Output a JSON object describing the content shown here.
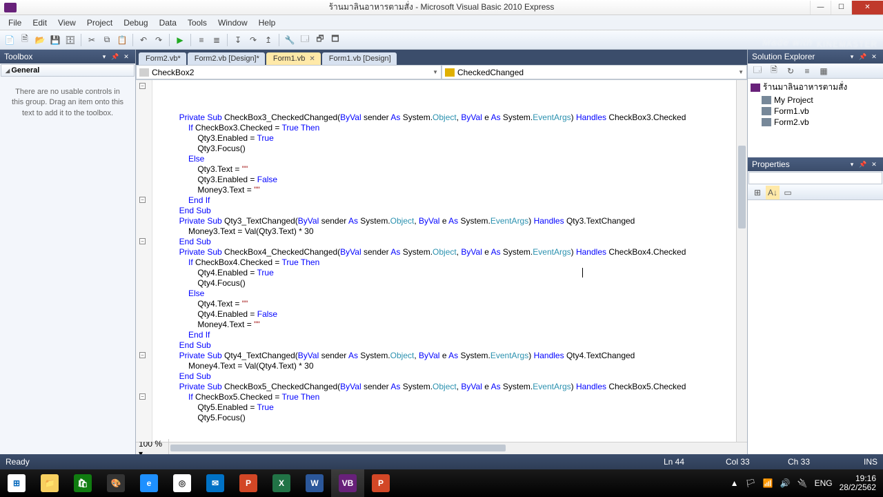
{
  "title": "ร้านมาลินอาหารตามสั่ง - Microsoft Visual Basic 2010 Express",
  "menu": [
    "File",
    "Edit",
    "View",
    "Project",
    "Debug",
    "Data",
    "Tools",
    "Window",
    "Help"
  ],
  "watermark_made": "Made with",
  "watermark": "KINEMASTER",
  "toolbox": {
    "title": "Toolbox",
    "category": "General",
    "message": "There are no usable controls in this group. Drag an item onto this text to add it to the toolbox."
  },
  "tabs": [
    {
      "label": "Form2.vb*",
      "active": false
    },
    {
      "label": "Form2.vb [Design]*",
      "active": false
    },
    {
      "label": "Form1.vb",
      "active": true,
      "close": true
    },
    {
      "label": "Form1.vb [Design]",
      "active": false
    }
  ],
  "dropdown_left": "CheckBox2",
  "dropdown_right": "CheckedChanged",
  "zoom": "100 %",
  "solution": {
    "title": "Solution Explorer",
    "project": "ร้านมาลินอาหารตามสั่ง",
    "items": [
      "My Project",
      "Form1.vb",
      "Form2.vb"
    ]
  },
  "properties": {
    "title": "Properties"
  },
  "status": {
    "ready": "Ready",
    "ln": "Ln 44",
    "col": "Col 33",
    "ch": "Ch 33",
    "ins": "INS"
  },
  "tray": {
    "lang": "ENG",
    "time": "19:16",
    "date": "28/2/2562"
  },
  "code_lines": [
    {
      "indent": 2,
      "tokens": [
        [
          "kw",
          "Private Sub"
        ],
        [
          "",
          " CheckBox3_CheckedChanged("
        ],
        [
          "kw",
          "ByVal"
        ],
        [
          "",
          " sender "
        ],
        [
          "kw",
          "As"
        ],
        [
          "",
          " System."
        ],
        [
          "cls",
          "Object"
        ],
        [
          "",
          ", "
        ],
        [
          "kw",
          "ByVal"
        ],
        [
          "",
          " e "
        ],
        [
          "kw",
          "As"
        ],
        [
          "",
          " System."
        ],
        [
          "cls",
          "EventArgs"
        ],
        [
          "",
          ") "
        ],
        [
          "kw",
          "Handles"
        ],
        [
          "",
          " CheckBox3.Checked"
        ]
      ],
      "box": true
    },
    {
      "indent": 3,
      "tokens": [
        [
          "kw",
          "If"
        ],
        [
          "",
          " CheckBox3.Checked = "
        ],
        [
          "kw",
          "True Then"
        ]
      ]
    },
    {
      "indent": 4,
      "tokens": [
        [
          "",
          "Qty3.Enabled = "
        ],
        [
          "kw",
          "True"
        ]
      ]
    },
    {
      "indent": 4,
      "tokens": [
        [
          "",
          "Qty3.Focus()"
        ]
      ]
    },
    {
      "indent": 3,
      "tokens": [
        [
          "kw",
          "Else"
        ]
      ]
    },
    {
      "indent": 4,
      "tokens": [
        [
          "",
          "Qty3.Text = "
        ],
        [
          "str",
          "\"\""
        ]
      ]
    },
    {
      "indent": 4,
      "tokens": [
        [
          "",
          "Qty3.Enabled = "
        ],
        [
          "kw",
          "False"
        ]
      ]
    },
    {
      "indent": 4,
      "tokens": [
        [
          "",
          "Money3.Text = "
        ],
        [
          "str",
          "\"\""
        ]
      ]
    },
    {
      "indent": 3,
      "tokens": [
        [
          "kw",
          "End If"
        ]
      ]
    },
    {
      "indent": 2,
      "tokens": [
        [
          "kw",
          "End Sub"
        ]
      ]
    },
    {
      "indent": 0,
      "tokens": [
        [
          "",
          ""
        ]
      ]
    },
    {
      "indent": 2,
      "tokens": [
        [
          "kw",
          "Private Sub"
        ],
        [
          "",
          " Qty3_TextChanged("
        ],
        [
          "kw",
          "ByVal"
        ],
        [
          "",
          " sender "
        ],
        [
          "kw",
          "As"
        ],
        [
          "",
          " System."
        ],
        [
          "cls",
          "Object"
        ],
        [
          "",
          ", "
        ],
        [
          "kw",
          "ByVal"
        ],
        [
          "",
          " e "
        ],
        [
          "kw",
          "As"
        ],
        [
          "",
          " System."
        ],
        [
          "cls",
          "EventArgs"
        ],
        [
          "",
          ") "
        ],
        [
          "kw",
          "Handles"
        ],
        [
          "",
          " Qty3.TextChanged"
        ]
      ],
      "box": true
    },
    {
      "indent": 3,
      "tokens": [
        [
          "",
          "Money3.Text = Val(Qty3.Text) * 30"
        ]
      ]
    },
    {
      "indent": 2,
      "tokens": [
        [
          "kw",
          "End Sub"
        ]
      ]
    },
    {
      "indent": 0,
      "tokens": [
        [
          "",
          ""
        ]
      ]
    },
    {
      "indent": 2,
      "tokens": [
        [
          "kw",
          "Private Sub"
        ],
        [
          "",
          " CheckBox4_CheckedChanged("
        ],
        [
          "kw",
          "ByVal"
        ],
        [
          "",
          " sender "
        ],
        [
          "kw",
          "As"
        ],
        [
          "",
          " System."
        ],
        [
          "cls",
          "Object"
        ],
        [
          "",
          ", "
        ],
        [
          "kw",
          "ByVal"
        ],
        [
          "",
          " e "
        ],
        [
          "kw",
          "As"
        ],
        [
          "",
          " System."
        ],
        [
          "cls",
          "EventArgs"
        ],
        [
          "",
          ") "
        ],
        [
          "kw",
          "Handles"
        ],
        [
          "",
          " CheckBox4.Checked"
        ]
      ],
      "box": true
    },
    {
      "indent": 3,
      "tokens": [
        [
          "kw",
          "If"
        ],
        [
          "",
          " CheckBox4.Checked = "
        ],
        [
          "kw",
          "True Then"
        ]
      ]
    },
    {
      "indent": 4,
      "tokens": [
        [
          "",
          "Qty4.Enabled = "
        ],
        [
          "kw",
          "True"
        ]
      ]
    },
    {
      "indent": 4,
      "tokens": [
        [
          "",
          "Qty4.Focus()"
        ]
      ]
    },
    {
      "indent": 3,
      "tokens": [
        [
          "kw",
          "Else"
        ]
      ]
    },
    {
      "indent": 4,
      "tokens": [
        [
          "",
          "Qty4.Text = "
        ],
        [
          "str",
          "\"\""
        ]
      ]
    },
    {
      "indent": 4,
      "tokens": [
        [
          "",
          "Qty4.Enabled = "
        ],
        [
          "kw",
          "False"
        ]
      ]
    },
    {
      "indent": 4,
      "tokens": [
        [
          "",
          "Money4.Text = "
        ],
        [
          "str",
          "\"\""
        ]
      ]
    },
    {
      "indent": 3,
      "tokens": [
        [
          "kw",
          "End If"
        ]
      ]
    },
    {
      "indent": 2,
      "tokens": [
        [
          "kw",
          "End Sub"
        ]
      ]
    },
    {
      "indent": 0,
      "tokens": [
        [
          "",
          ""
        ]
      ]
    },
    {
      "indent": 2,
      "tokens": [
        [
          "kw",
          "Private Sub"
        ],
        [
          "",
          " Qty4_TextChanged("
        ],
        [
          "kw",
          "ByVal"
        ],
        [
          "",
          " sender "
        ],
        [
          "kw",
          "As"
        ],
        [
          "",
          " System."
        ],
        [
          "cls",
          "Object"
        ],
        [
          "",
          ", "
        ],
        [
          "kw",
          "ByVal"
        ],
        [
          "",
          " e "
        ],
        [
          "kw",
          "As"
        ],
        [
          "",
          " System."
        ],
        [
          "cls",
          "EventArgs"
        ],
        [
          "",
          ") "
        ],
        [
          "kw",
          "Handles"
        ],
        [
          "",
          " Qty4.TextChanged"
        ]
      ],
      "box": true
    },
    {
      "indent": 3,
      "tokens": [
        [
          "",
          "Money4.Text = Val(Qty4.Text) * 30"
        ]
      ]
    },
    {
      "indent": 2,
      "tokens": [
        [
          "kw",
          "End Sub"
        ]
      ]
    },
    {
      "indent": 0,
      "tokens": [
        [
          "",
          ""
        ]
      ]
    },
    {
      "indent": 2,
      "tokens": [
        [
          "kw",
          "Private Sub"
        ],
        [
          "",
          " CheckBox5_CheckedChanged("
        ],
        [
          "kw",
          "ByVal"
        ],
        [
          "",
          " sender "
        ],
        [
          "kw",
          "As"
        ],
        [
          "",
          " System."
        ],
        [
          "cls",
          "Object"
        ],
        [
          "",
          ", "
        ],
        [
          "kw",
          "ByVal"
        ],
        [
          "",
          " e "
        ],
        [
          "kw",
          "As"
        ],
        [
          "",
          " System."
        ],
        [
          "cls",
          "EventArgs"
        ],
        [
          "",
          ") "
        ],
        [
          "kw",
          "Handles"
        ],
        [
          "",
          " CheckBox5.Checked"
        ]
      ],
      "box": true
    },
    {
      "indent": 3,
      "tokens": [
        [
          "kw",
          "If"
        ],
        [
          "",
          " CheckBox5.Checked = "
        ],
        [
          "kw",
          "True Then"
        ]
      ]
    },
    {
      "indent": 4,
      "tokens": [
        [
          "",
          "Qty5.Enabled = "
        ],
        [
          "kw",
          "True"
        ]
      ]
    },
    {
      "indent": 4,
      "tokens": [
        [
          "",
          "Qty5.Focus()"
        ]
      ]
    }
  ]
}
